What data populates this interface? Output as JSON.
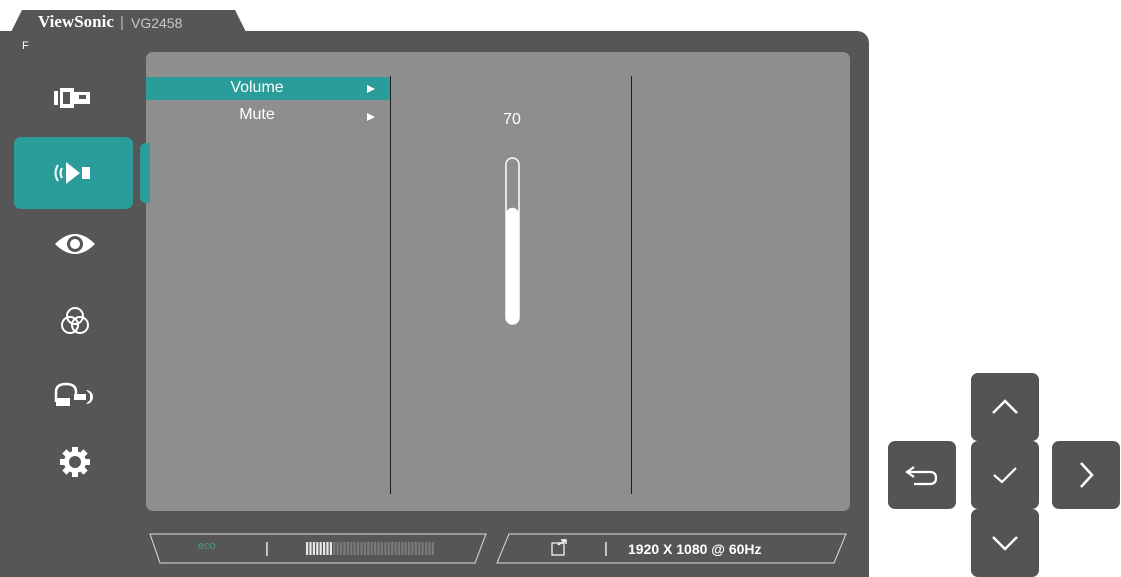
{
  "header": {
    "brand": "ViewSonic",
    "separator": "|",
    "model": "VG2458"
  },
  "osd": {
    "top_left_label": "F"
  },
  "sidebar": {
    "items": [
      {
        "name": "input-icon",
        "selected": false
      },
      {
        "name": "audio-icon",
        "selected": true
      },
      {
        "name": "eye-icon",
        "selected": false
      },
      {
        "name": "color-icon",
        "selected": false
      },
      {
        "name": "manual-adjust-icon",
        "selected": false
      },
      {
        "name": "setup-icon",
        "selected": false
      }
    ]
  },
  "submenu": {
    "items": [
      {
        "label": "Volume",
        "selected": true
      },
      {
        "label": "Mute",
        "selected": false
      }
    ]
  },
  "volume": {
    "value": "70",
    "level_fraction": 0.7
  },
  "status": {
    "eco_label": "eco",
    "separator1": "|",
    "separator2": "|",
    "resolution": "1920 X 1080 @ 60Hz"
  },
  "colors": {
    "accent": "#2a9d9b",
    "panel": "#8e8e8e",
    "frame": "#565656"
  },
  "nav": [
    "up-button",
    "back-button",
    "confirm-button",
    "right-button",
    "down-button"
  ]
}
